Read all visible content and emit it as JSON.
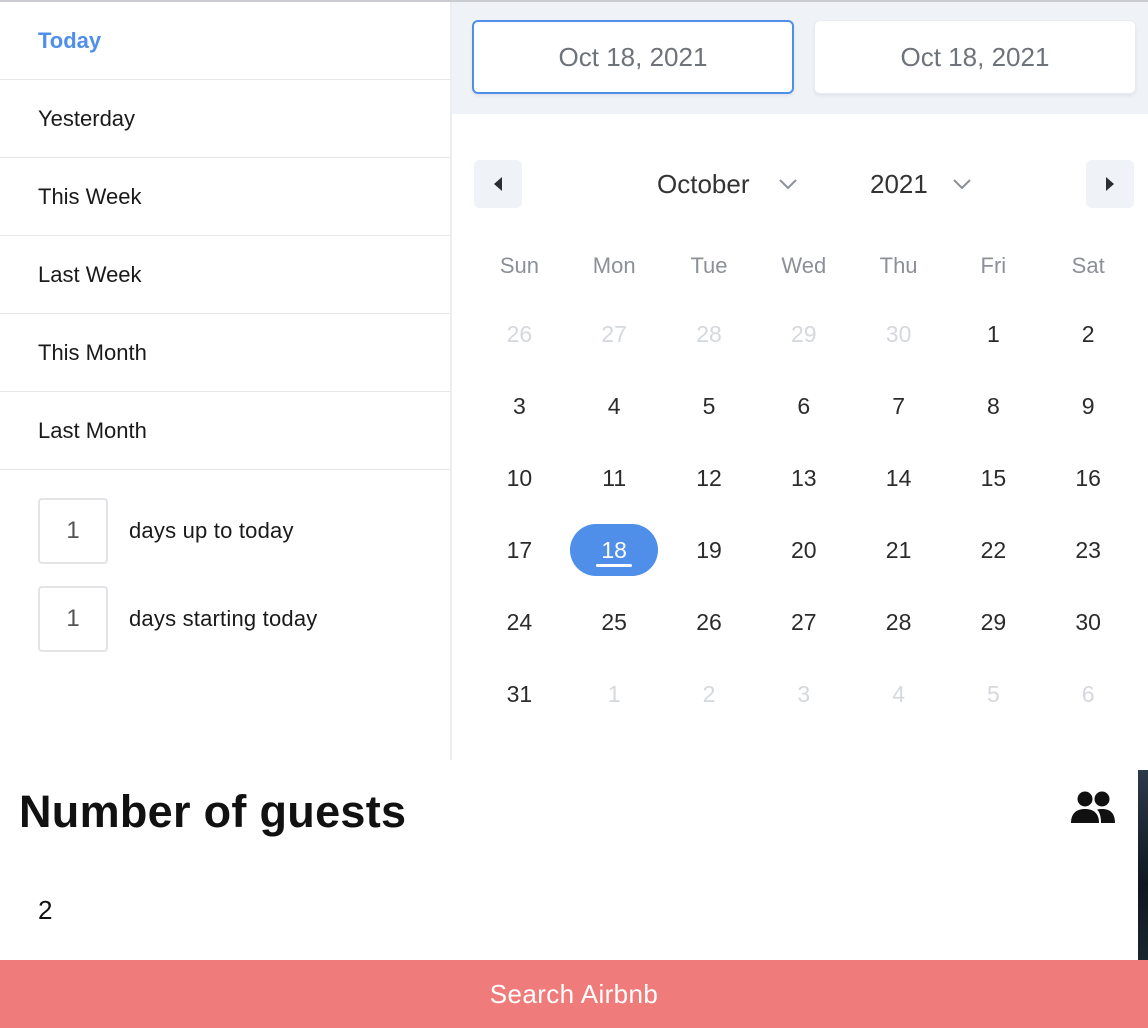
{
  "ranges": {
    "items": [
      {
        "label": "Today",
        "active": true
      },
      {
        "label": "Yesterday"
      },
      {
        "label": "This Week"
      },
      {
        "label": "Last Week"
      },
      {
        "label": "This Month"
      },
      {
        "label": "Last Month"
      }
    ],
    "static": [
      {
        "value": "1",
        "label": "days up to today"
      },
      {
        "value": "1",
        "label": "days starting today"
      }
    ]
  },
  "calendar": {
    "start_date": "Oct 18, 2021",
    "end_date": "Oct 18, 2021",
    "month": "October",
    "year": "2021",
    "weekdays": [
      "Sun",
      "Mon",
      "Tue",
      "Wed",
      "Thu",
      "Fri",
      "Sat"
    ],
    "days": [
      {
        "d": "26",
        "muted": true
      },
      {
        "d": "27",
        "muted": true
      },
      {
        "d": "28",
        "muted": true
      },
      {
        "d": "29",
        "muted": true
      },
      {
        "d": "30",
        "muted": true
      },
      {
        "d": "1"
      },
      {
        "d": "2"
      },
      {
        "d": "3"
      },
      {
        "d": "4"
      },
      {
        "d": "5"
      },
      {
        "d": "6"
      },
      {
        "d": "7"
      },
      {
        "d": "8"
      },
      {
        "d": "9"
      },
      {
        "d": "10"
      },
      {
        "d": "11"
      },
      {
        "d": "12"
      },
      {
        "d": "13"
      },
      {
        "d": "14"
      },
      {
        "d": "15"
      },
      {
        "d": "16"
      },
      {
        "d": "17"
      },
      {
        "d": "18",
        "selected": true
      },
      {
        "d": "19"
      },
      {
        "d": "20"
      },
      {
        "d": "21"
      },
      {
        "d": "22"
      },
      {
        "d": "23"
      },
      {
        "d": "24"
      },
      {
        "d": "25"
      },
      {
        "d": "26"
      },
      {
        "d": "27"
      },
      {
        "d": "28"
      },
      {
        "d": "29"
      },
      {
        "d": "30"
      },
      {
        "d": "31"
      },
      {
        "d": "1",
        "muted": true
      },
      {
        "d": "2",
        "muted": true
      },
      {
        "d": "3",
        "muted": true
      },
      {
        "d": "4",
        "muted": true
      },
      {
        "d": "5",
        "muted": true
      },
      {
        "d": "6",
        "muted": true
      }
    ],
    "icons": {
      "prev": "caret-left-icon",
      "next": "caret-right-icon",
      "dropdown": "chevron-down-icon"
    }
  },
  "guests": {
    "title": "Number of guests",
    "value": "2",
    "icon": "people-icon"
  },
  "search": {
    "label": "Search Airbnb"
  },
  "colors": {
    "accent": "#4f8fea",
    "search_button": "#ef7c7a",
    "date_bar": "#eff2f7"
  }
}
